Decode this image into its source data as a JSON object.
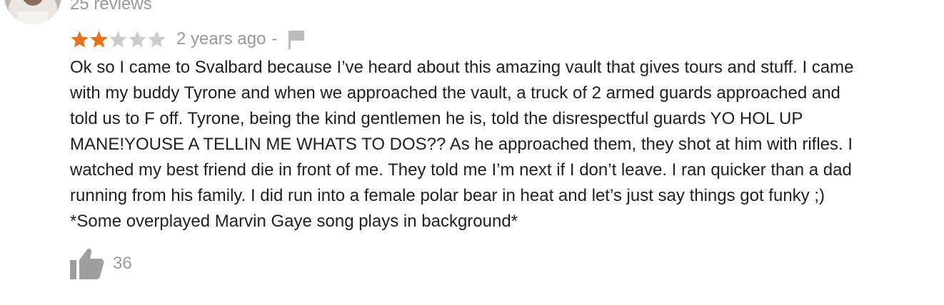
{
  "reviewer": {
    "review_count": "25 reviews"
  },
  "rating": {
    "value": 2,
    "max": 5,
    "filled_color": "#e7711b",
    "empty_color": "#cccccc"
  },
  "review": {
    "time_ago": "2 years ago",
    "separator": "-",
    "text": "Ok so I came to Svalbard because I’ve heard about this amazing vault that gives tours and stuff. I came\nwith my buddy Tyrone and when we approached the vault, a truck of 2 armed guards approached and\ntold us to F off. Tyrone, being the kind gentlemen he is, told the disrespectful guards YO HOL UP\nMANE!YOUSE A TELLIN ME WHATS TO DOS?? As he approached them, they shot at him with rifles. I\nwatched my best friend die in front of me. They told me I’m next if I don’t leave. I ran quicker than a dad\nrunning from his family. I did run into a female polar bear in heat and let’s just say things got funky ;)\n*Some overplayed Marvin Gaye song plays in background*"
  },
  "actions": {
    "like_count": "36",
    "flag_icon": "flag-icon",
    "like_icon": "thumbs-up-icon"
  }
}
